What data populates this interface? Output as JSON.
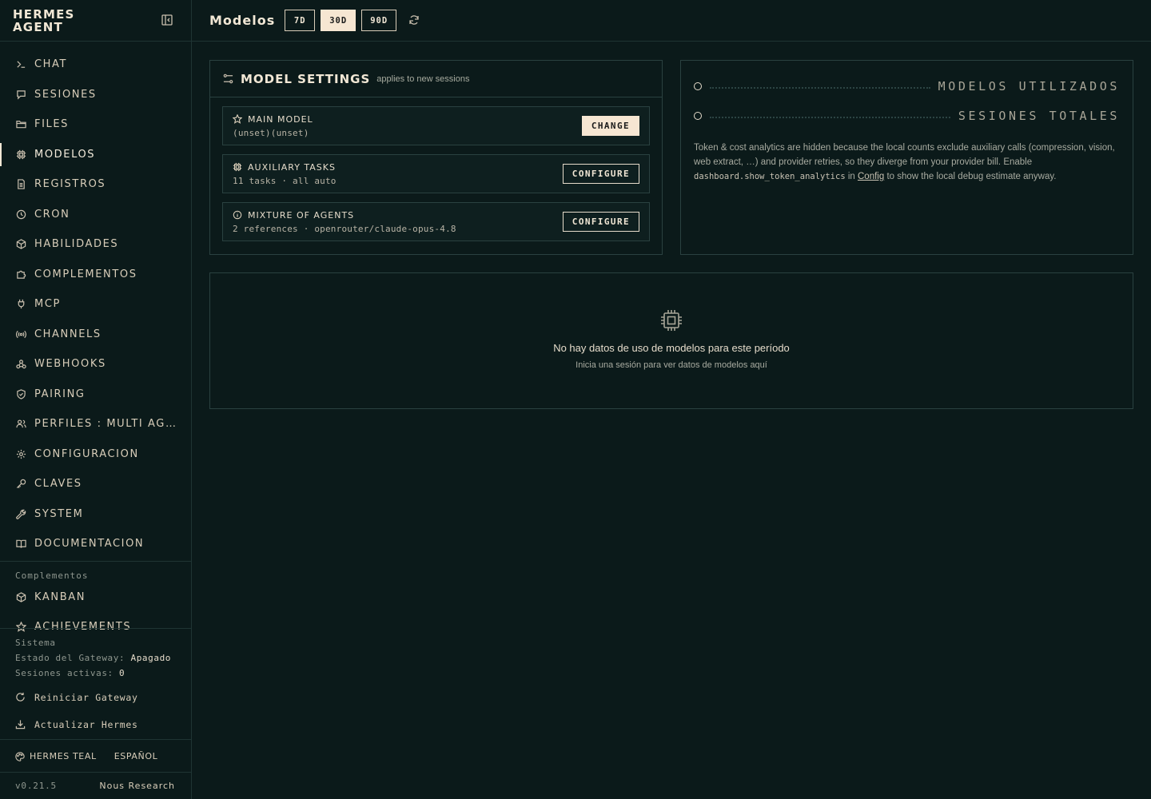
{
  "brand": {
    "title": "HERMES\nAGENT"
  },
  "nav": [
    {
      "label": "CHAT",
      "icon": "terminal-icon"
    },
    {
      "label": "SESIONES",
      "icon": "chat-icon"
    },
    {
      "label": "FILES",
      "icon": "folder-icon"
    },
    {
      "label": "MODELOS",
      "icon": "cpu-icon",
      "active": true
    },
    {
      "label": "REGISTROS",
      "icon": "document-icon"
    },
    {
      "label": "CRON",
      "icon": "clock-icon"
    },
    {
      "label": "HABILIDADES",
      "icon": "package-icon"
    },
    {
      "label": "COMPLEMENTOS",
      "icon": "puzzle-icon"
    },
    {
      "label": "MCP",
      "icon": "plug-icon"
    },
    {
      "label": "CHANNELS",
      "icon": "radio-icon"
    },
    {
      "label": "WEBHOOKS",
      "icon": "webhook-icon"
    },
    {
      "label": "PAIRING",
      "icon": "shield-check-icon"
    },
    {
      "label": "PERFILES : MULTI AGENTS",
      "icon": "users-icon"
    },
    {
      "label": "CONFIGURACIÓN",
      "icon": "gear-icon"
    },
    {
      "label": "CLAVES",
      "icon": "key-icon"
    },
    {
      "label": "SYSTEM",
      "icon": "wrench-icon"
    },
    {
      "label": "DOCUMENTACIÓN",
      "icon": "book-icon"
    }
  ],
  "plugins": {
    "label": "Complementos",
    "items": [
      {
        "label": "KANBAN",
        "icon": "package-icon"
      },
      {
        "label": "ACHIEVEMENTS",
        "icon": "star-icon"
      }
    ]
  },
  "system": {
    "label": "Sistema",
    "gateway_label": "Estado del Gateway:",
    "gateway_value": "Apagado",
    "sessions_label": "Sesiones activas:",
    "sessions_value": "0",
    "restart": "Reiniciar Gateway",
    "update": "Actualizar Hermes"
  },
  "theme": {
    "label": "HERMES TEAL",
    "language": "ESPAÑOL"
  },
  "footer": {
    "version": "v0.21.5",
    "org": "Nous Research"
  },
  "header": {
    "title": "Modelos",
    "periods": [
      {
        "label": "7D",
        "active": false
      },
      {
        "label": "30D",
        "active": true
      },
      {
        "label": "90D",
        "active": false
      }
    ]
  },
  "model_settings": {
    "title": "MODEL SETTINGS",
    "subtitle": "applies to new sessions",
    "rows": [
      {
        "label": "MAIN MODEL",
        "desc": "(unset)(unset)",
        "button": "CHANGE",
        "icon": "star-icon"
      },
      {
        "label": "AUXILIARY TASKS",
        "desc": "11 tasks · all auto",
        "button": "CONFIGURE",
        "icon": "cpu-icon"
      },
      {
        "label": "MIXTURE OF AGENTS",
        "desc": "2 references · openrouter/claude-opus-4.8",
        "button": "CONFIGURE",
        "icon": "info-icon"
      }
    ]
  },
  "stats": {
    "models_used": "MODELOS UTILIZADOS",
    "total_sessions": "SESIONES TOTALES",
    "note_pre": "Token & cost analytics are hidden because the local counts exclude auxiliary calls (compression, vision, web extract, …) and provider retries, so they diverge from your provider bill. Enable ",
    "note_code": "dashboard.show_token_analytics",
    "note_mid": " in ",
    "note_link": "Config",
    "note_post": " to show the local debug estimate anyway."
  },
  "empty": {
    "title": "No hay datos de uso de modelos para este período",
    "subtitle": "Inicia una sesión para ver datos de modelos aquí"
  },
  "colors": {
    "accent": "#f6e6d2",
    "background": "#0b1a1a",
    "border": "#2a4140"
  }
}
